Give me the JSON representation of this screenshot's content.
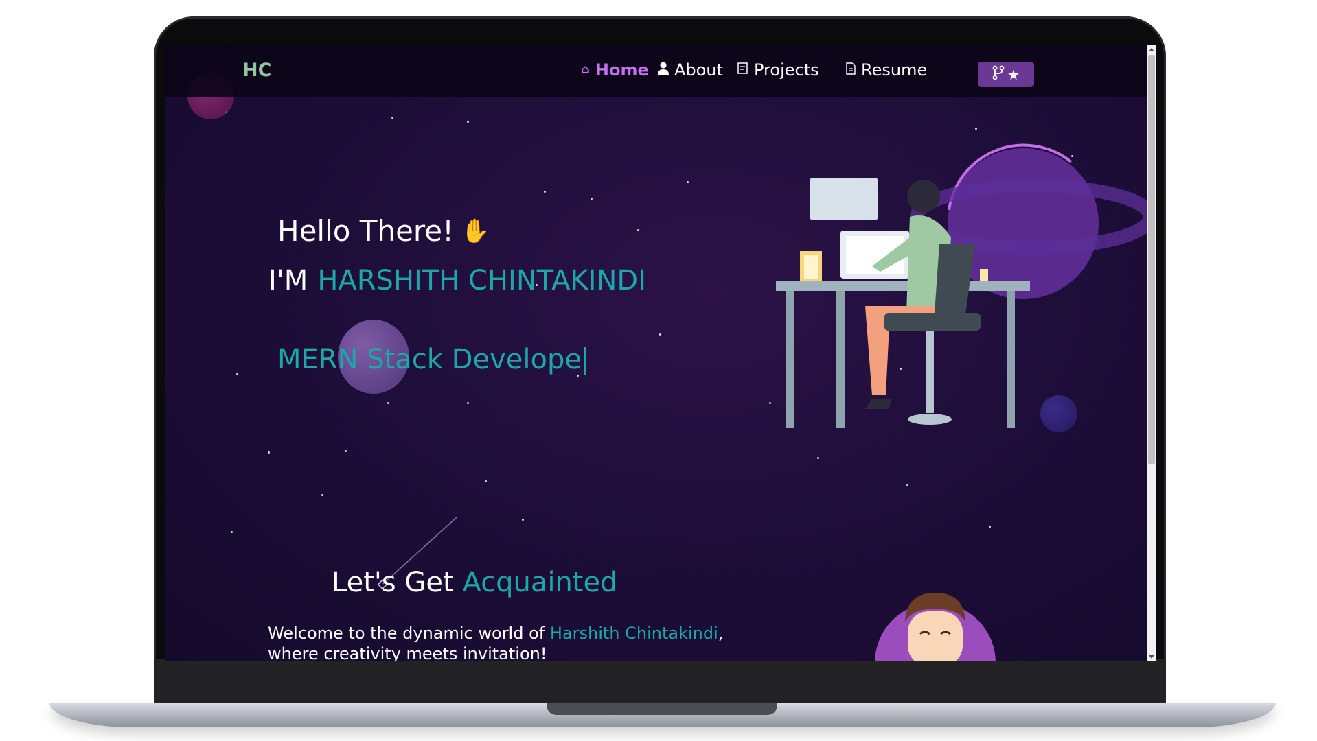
{
  "navbar": {
    "logo": "HC",
    "items": [
      {
        "label": "Home",
        "icon": "home-icon",
        "active": true
      },
      {
        "label": "About",
        "icon": "user-icon",
        "active": false
      },
      {
        "label": "Projects",
        "icon": "projects-icon",
        "active": false
      },
      {
        "label": "Resume",
        "icon": "document-icon",
        "active": false
      }
    ],
    "fork_button": {
      "icons": [
        "git-fork-icon",
        "star-icon"
      ]
    }
  },
  "hero": {
    "greeting": "Hello There!",
    "greeting_emoji": "✋",
    "im_prefix": "I'M",
    "name": "HARSHITH CHINTAKINDI",
    "typed_text": "MERN Stack Develope"
  },
  "intro": {
    "heading_prefix": "Let's Get",
    "heading_highlight": "Acquainted",
    "welcome_prefix": "Welcome to the dynamic world of",
    "welcome_name": "Harshith Chintakindi",
    "welcome_suffix": ",",
    "welcome_line2": "where creativity meets invitation!"
  },
  "colors": {
    "accent_teal": "#1aa8a8",
    "accent_purple": "#c770f0",
    "logo_green": "#8fc6a0",
    "background": "#1e0e3a"
  }
}
